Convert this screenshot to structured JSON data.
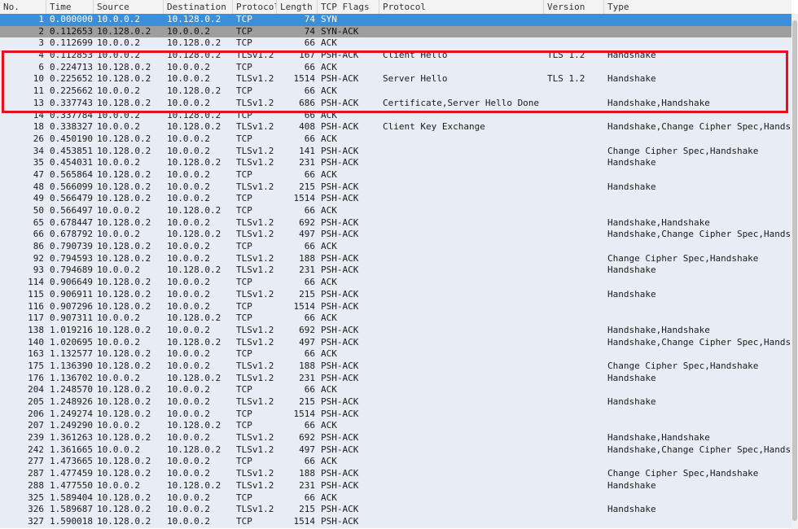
{
  "columns": {
    "no": "No.",
    "time": "Time",
    "source": "Source",
    "destination": "Destination",
    "protocol": "Protocol",
    "length": "Length",
    "flags": "TCP Flags",
    "info": "Protocol",
    "version": "Version",
    "type": "Type"
  },
  "rows": [
    {
      "no": "1",
      "time": "0.000000",
      "src": "10.0.0.2",
      "dst": "10.128.0.2",
      "proto": "TCP",
      "len": "74",
      "flags": "SYN",
      "info": "",
      "ver": "",
      "type": ""
    },
    {
      "no": "2",
      "time": "0.112653",
      "src": "10.128.0.2",
      "dst": "10.0.0.2",
      "proto": "TCP",
      "len": "74",
      "flags": "SYN-ACK",
      "info": "",
      "ver": "",
      "type": ""
    },
    {
      "no": "3",
      "time": "0.112699",
      "src": "10.0.0.2",
      "dst": "10.128.0.2",
      "proto": "TCP",
      "len": "66",
      "flags": "ACK",
      "info": "",
      "ver": "",
      "type": ""
    },
    {
      "no": "4",
      "time": "0.112853",
      "src": "10.0.0.2",
      "dst": "10.128.0.2",
      "proto": "TLSv1.2",
      "len": "167",
      "flags": "PSH-ACK",
      "info": "Client Hello",
      "ver": "TLS 1.2",
      "type": "Handshake"
    },
    {
      "no": "6",
      "time": "0.224713",
      "src": "10.128.0.2",
      "dst": "10.0.0.2",
      "proto": "TCP",
      "len": "66",
      "flags": "ACK",
      "info": "",
      "ver": "",
      "type": ""
    },
    {
      "no": "10",
      "time": "0.225652",
      "src": "10.128.0.2",
      "dst": "10.0.0.2",
      "proto": "TLSv1.2",
      "len": "1514",
      "flags": "PSH-ACK",
      "info": "Server Hello",
      "ver": "TLS 1.2",
      "type": "Handshake"
    },
    {
      "no": "11",
      "time": "0.225662",
      "src": "10.0.0.2",
      "dst": "10.128.0.2",
      "proto": "TCP",
      "len": "66",
      "flags": "ACK",
      "info": "",
      "ver": "",
      "type": ""
    },
    {
      "no": "13",
      "time": "0.337743",
      "src": "10.128.0.2",
      "dst": "10.0.0.2",
      "proto": "TLSv1.2",
      "len": "686",
      "flags": "PSH-ACK",
      "info": "Certificate,Server Hello Done",
      "ver": "",
      "type": "Handshake,Handshake"
    },
    {
      "no": "14",
      "time": "0.337784",
      "src": "10.0.0.2",
      "dst": "10.128.0.2",
      "proto": "TCP",
      "len": "66",
      "flags": "ACK",
      "info": "",
      "ver": "",
      "type": ""
    },
    {
      "no": "18",
      "time": "0.338327",
      "src": "10.0.0.2",
      "dst": "10.128.0.2",
      "proto": "TLSv1.2",
      "len": "408",
      "flags": "PSH-ACK",
      "info": "Client Key Exchange",
      "ver": "",
      "type": "Handshake,Change Cipher Spec,Handsh"
    },
    {
      "no": "26",
      "time": "0.450190",
      "src": "10.128.0.2",
      "dst": "10.0.0.2",
      "proto": "TCP",
      "len": "66",
      "flags": "ACK",
      "info": "",
      "ver": "",
      "type": ""
    },
    {
      "no": "34",
      "time": "0.453851",
      "src": "10.128.0.2",
      "dst": "10.0.0.2",
      "proto": "TLSv1.2",
      "len": "141",
      "flags": "PSH-ACK",
      "info": "",
      "ver": "",
      "type": "Change Cipher Spec,Handshake"
    },
    {
      "no": "35",
      "time": "0.454031",
      "src": "10.0.0.2",
      "dst": "10.128.0.2",
      "proto": "TLSv1.2",
      "len": "231",
      "flags": "PSH-ACK",
      "info": "",
      "ver": "",
      "type": "Handshake"
    },
    {
      "no": "47",
      "time": "0.565864",
      "src": "10.128.0.2",
      "dst": "10.0.0.2",
      "proto": "TCP",
      "len": "66",
      "flags": "ACK",
      "info": "",
      "ver": "",
      "type": ""
    },
    {
      "no": "48",
      "time": "0.566099",
      "src": "10.128.0.2",
      "dst": "10.0.0.2",
      "proto": "TLSv1.2",
      "len": "215",
      "flags": "PSH-ACK",
      "info": "",
      "ver": "",
      "type": "Handshake"
    },
    {
      "no": "49",
      "time": "0.566479",
      "src": "10.128.0.2",
      "dst": "10.0.0.2",
      "proto": "TCP",
      "len": "1514",
      "flags": "PSH-ACK",
      "info": "",
      "ver": "",
      "type": ""
    },
    {
      "no": "50",
      "time": "0.566497",
      "src": "10.0.0.2",
      "dst": "10.128.0.2",
      "proto": "TCP",
      "len": "66",
      "flags": "ACK",
      "info": "",
      "ver": "",
      "type": ""
    },
    {
      "no": "65",
      "time": "0.678447",
      "src": "10.128.0.2",
      "dst": "10.0.0.2",
      "proto": "TLSv1.2",
      "len": "692",
      "flags": "PSH-ACK",
      "info": "",
      "ver": "",
      "type": "Handshake,Handshake"
    },
    {
      "no": "66",
      "time": "0.678792",
      "src": "10.0.0.2",
      "dst": "10.128.0.2",
      "proto": "TLSv1.2",
      "len": "497",
      "flags": "PSH-ACK",
      "info": "",
      "ver": "",
      "type": "Handshake,Change Cipher Spec,Handsh"
    },
    {
      "no": "86",
      "time": "0.790739",
      "src": "10.128.0.2",
      "dst": "10.0.0.2",
      "proto": "TCP",
      "len": "66",
      "flags": "ACK",
      "info": "",
      "ver": "",
      "type": ""
    },
    {
      "no": "92",
      "time": "0.794593",
      "src": "10.128.0.2",
      "dst": "10.0.0.2",
      "proto": "TLSv1.2",
      "len": "188",
      "flags": "PSH-ACK",
      "info": "",
      "ver": "",
      "type": "Change Cipher Spec,Handshake"
    },
    {
      "no": "93",
      "time": "0.794689",
      "src": "10.0.0.2",
      "dst": "10.128.0.2",
      "proto": "TLSv1.2",
      "len": "231",
      "flags": "PSH-ACK",
      "info": "",
      "ver": "",
      "type": "Handshake"
    },
    {
      "no": "114",
      "time": "0.906649",
      "src": "10.128.0.2",
      "dst": "10.0.0.2",
      "proto": "TCP",
      "len": "66",
      "flags": "ACK",
      "info": "",
      "ver": "",
      "type": ""
    },
    {
      "no": "115",
      "time": "0.906911",
      "src": "10.128.0.2",
      "dst": "10.0.0.2",
      "proto": "TLSv1.2",
      "len": "215",
      "flags": "PSH-ACK",
      "info": "",
      "ver": "",
      "type": "Handshake"
    },
    {
      "no": "116",
      "time": "0.907296",
      "src": "10.128.0.2",
      "dst": "10.0.0.2",
      "proto": "TCP",
      "len": "1514",
      "flags": "PSH-ACK",
      "info": "",
      "ver": "",
      "type": ""
    },
    {
      "no": "117",
      "time": "0.907311",
      "src": "10.0.0.2",
      "dst": "10.128.0.2",
      "proto": "TCP",
      "len": "66",
      "flags": "ACK",
      "info": "",
      "ver": "",
      "type": ""
    },
    {
      "no": "138",
      "time": "1.019216",
      "src": "10.128.0.2",
      "dst": "10.0.0.2",
      "proto": "TLSv1.2",
      "len": "692",
      "flags": "PSH-ACK",
      "info": "",
      "ver": "",
      "type": "Handshake,Handshake"
    },
    {
      "no": "140",
      "time": "1.020695",
      "src": "10.0.0.2",
      "dst": "10.128.0.2",
      "proto": "TLSv1.2",
      "len": "497",
      "flags": "PSH-ACK",
      "info": "",
      "ver": "",
      "type": "Handshake,Change Cipher Spec,Handsh"
    },
    {
      "no": "163",
      "time": "1.132577",
      "src": "10.128.0.2",
      "dst": "10.0.0.2",
      "proto": "TCP",
      "len": "66",
      "flags": "ACK",
      "info": "",
      "ver": "",
      "type": ""
    },
    {
      "no": "175",
      "time": "1.136390",
      "src": "10.128.0.2",
      "dst": "10.0.0.2",
      "proto": "TLSv1.2",
      "len": "188",
      "flags": "PSH-ACK",
      "info": "",
      "ver": "",
      "type": "Change Cipher Spec,Handshake"
    },
    {
      "no": "176",
      "time": "1.136702",
      "src": "10.0.0.2",
      "dst": "10.128.0.2",
      "proto": "TLSv1.2",
      "len": "231",
      "flags": "PSH-ACK",
      "info": "",
      "ver": "",
      "type": "Handshake"
    },
    {
      "no": "204",
      "time": "1.248570",
      "src": "10.128.0.2",
      "dst": "10.0.0.2",
      "proto": "TCP",
      "len": "66",
      "flags": "ACK",
      "info": "",
      "ver": "",
      "type": ""
    },
    {
      "no": "205",
      "time": "1.248926",
      "src": "10.128.0.2",
      "dst": "10.0.0.2",
      "proto": "TLSv1.2",
      "len": "215",
      "flags": "PSH-ACK",
      "info": "",
      "ver": "",
      "type": "Handshake"
    },
    {
      "no": "206",
      "time": "1.249274",
      "src": "10.128.0.2",
      "dst": "10.0.0.2",
      "proto": "TCP",
      "len": "1514",
      "flags": "PSH-ACK",
      "info": "",
      "ver": "",
      "type": ""
    },
    {
      "no": "207",
      "time": "1.249290",
      "src": "10.0.0.2",
      "dst": "10.128.0.2",
      "proto": "TCP",
      "len": "66",
      "flags": "ACK",
      "info": "",
      "ver": "",
      "type": ""
    },
    {
      "no": "239",
      "time": "1.361263",
      "src": "10.128.0.2",
      "dst": "10.0.0.2",
      "proto": "TLSv1.2",
      "len": "692",
      "flags": "PSH-ACK",
      "info": "",
      "ver": "",
      "type": "Handshake,Handshake"
    },
    {
      "no": "242",
      "time": "1.361665",
      "src": "10.0.0.2",
      "dst": "10.128.0.2",
      "proto": "TLSv1.2",
      "len": "497",
      "flags": "PSH-ACK",
      "info": "",
      "ver": "",
      "type": "Handshake,Change Cipher Spec,Handsh"
    },
    {
      "no": "277",
      "time": "1.473665",
      "src": "10.128.0.2",
      "dst": "10.0.0.2",
      "proto": "TCP",
      "len": "66",
      "flags": "ACK",
      "info": "",
      "ver": "",
      "type": ""
    },
    {
      "no": "287",
      "time": "1.477459",
      "src": "10.128.0.2",
      "dst": "10.0.0.2",
      "proto": "TLSv1.2",
      "len": "188",
      "flags": "PSH-ACK",
      "info": "",
      "ver": "",
      "type": "Change Cipher Spec,Handshake"
    },
    {
      "no": "288",
      "time": "1.477550",
      "src": "10.0.0.2",
      "dst": "10.128.0.2",
      "proto": "TLSv1.2",
      "len": "231",
      "flags": "PSH-ACK",
      "info": "",
      "ver": "",
      "type": "Handshake"
    },
    {
      "no": "325",
      "time": "1.589404",
      "src": "10.128.0.2",
      "dst": "10.0.0.2",
      "proto": "TCP",
      "len": "66",
      "flags": "ACK",
      "info": "",
      "ver": "",
      "type": ""
    },
    {
      "no": "326",
      "time": "1.589687",
      "src": "10.128.0.2",
      "dst": "10.0.0.2",
      "proto": "TLSv1.2",
      "len": "215",
      "flags": "PSH-ACK",
      "info": "",
      "ver": "",
      "type": "Handshake"
    },
    {
      "no": "327",
      "time": "1.590018",
      "src": "10.128.0.2",
      "dst": "10.0.0.2",
      "proto": "TCP",
      "len": "1514",
      "flags": "PSH-ACK",
      "info": "",
      "ver": "",
      "type": ""
    }
  ],
  "selected_rows": {
    "primary": "1",
    "secondary": "2"
  },
  "colors": {
    "row_bg": "#e8edf5",
    "selected_primary": "#3b8fd8",
    "selected_secondary": "#9e9e9e",
    "highlight_box": "#e8101a"
  }
}
